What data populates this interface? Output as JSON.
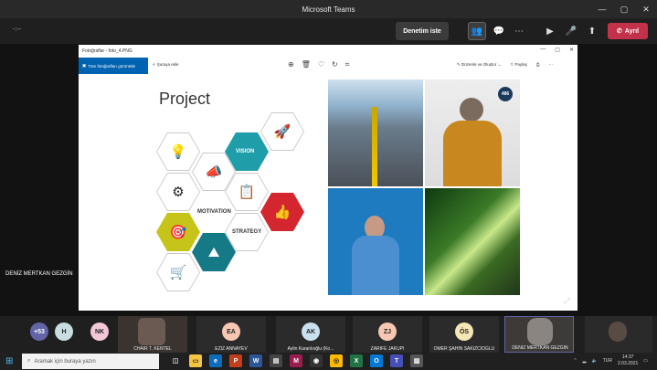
{
  "window": {
    "title": "Microsoft Teams"
  },
  "meeting": {
    "timer": "-:--",
    "request_control_label": "Denetim iste",
    "leave_label": "Ayrıl",
    "shared_by": "DENİZ MERTKAN GEZGİN"
  },
  "photos_app": {
    "title": "Fotoğraflar - foto_4.PNG",
    "all_photos_label": "Tüm fotoğrafları görüntüle",
    "add_label": "Şuraya ekle",
    "edit_label": "Düzenle ve Oluştur",
    "share_label": "Paylaş",
    "slide_title": "Project",
    "hex_labels": {
      "vision": "VISION",
      "motivation": "MOTIVATION",
      "strategy": "STRATEGY"
    },
    "badge": "486"
  },
  "gallery": {
    "overflow": "+53",
    "participants": [
      {
        "initials": "H",
        "name": "",
        "color": "#c8dde0"
      },
      {
        "initials": "NK",
        "name": "",
        "color": "#f4c7d8"
      },
      {
        "initials": "",
        "name": "CHAİR T. KENTEL",
        "color": ""
      },
      {
        "initials": "EA",
        "name": "EZİZ ANNAYEV",
        "color": "#f6c7b3"
      },
      {
        "initials": "AK",
        "name": "Aylin Karanlıoğlu (Ko...",
        "color": "#c9e1ef"
      },
      {
        "initials": "ZJ",
        "name": "ZARİFE JAKUPİ",
        "color": "#f6c7b3"
      },
      {
        "initials": "ÖS",
        "name": "ÖMER ŞAHİN SAKIZCIOĞLU",
        "color": "#f5e6b5"
      },
      {
        "initials": "",
        "name": "DENİZ MERTKAN GEZGİN",
        "color": ""
      }
    ]
  },
  "taskbar": {
    "search_placeholder": "Aramak için buraya yazın",
    "lang": "TUR",
    "time": "14:37",
    "date": "2.03.2021"
  }
}
